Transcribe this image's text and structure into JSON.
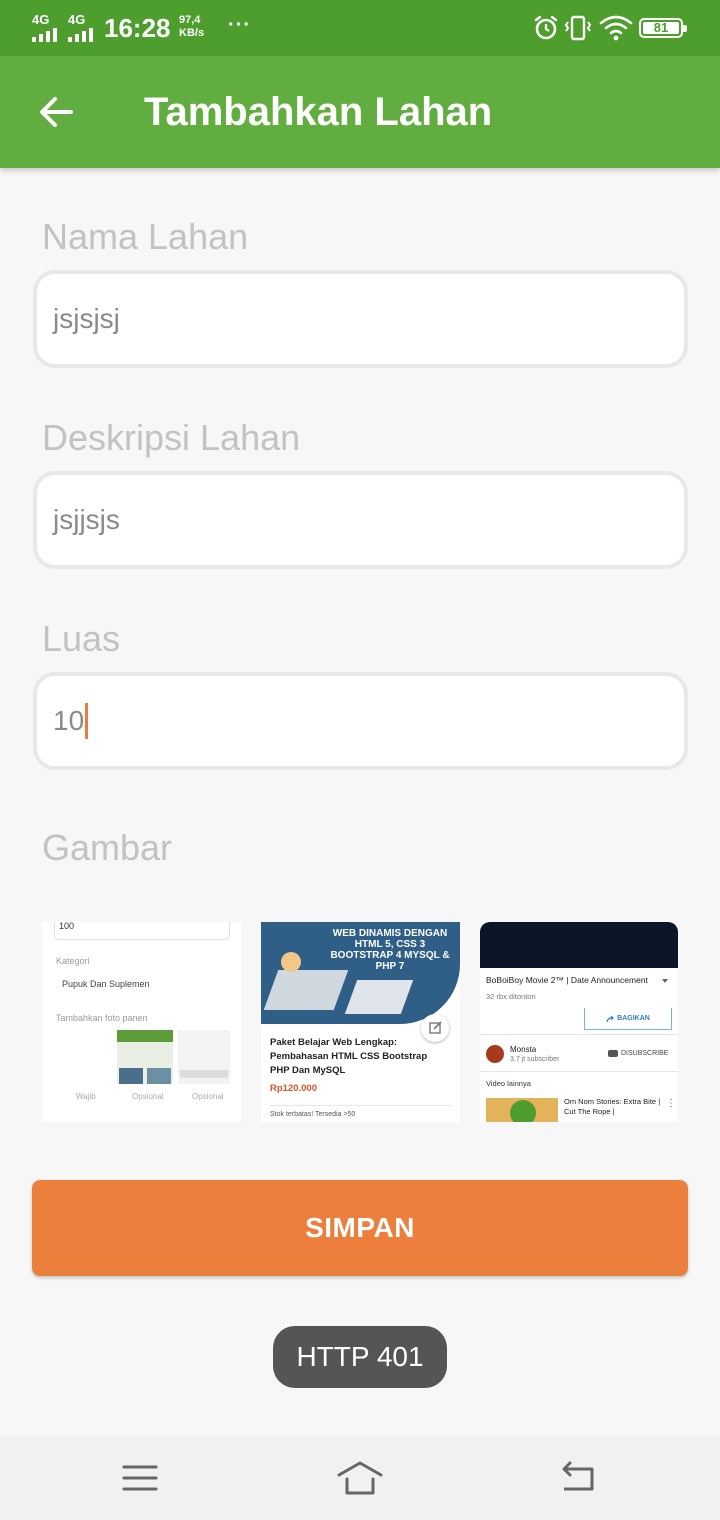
{
  "status_bar": {
    "sim1": "4G",
    "sim2": "4G",
    "time": "16:28",
    "speed_value": "97,4",
    "speed_unit": "KB/s",
    "more": "···",
    "battery": "81"
  },
  "app_bar": {
    "title": "Tambahkan Lahan"
  },
  "form": {
    "name_label": "Nama Lahan",
    "name_value": "jsjsjsj",
    "desc_label": "Deskripsi Lahan",
    "desc_value": "jsjjsjs",
    "area_label": "Luas",
    "area_value": "10",
    "image_label": "Gambar"
  },
  "thumbnails": {
    "t1": {
      "value": "100",
      "kategori": "Kategori",
      "kategori_value": "Pupuk Dan Suplemen",
      "foto": "Tambahkan foto panen",
      "cap1": "Wajib",
      "cap2": "Opsional",
      "cap3": "Opsional"
    },
    "t2": {
      "banner": "WEB DINAMIS DENGAN HTML 5, CSS 3 BOOTSTRAP 4 MYSQL & PHP 7",
      "title": "Paket Belajar Web Lengkap: Pembahasan HTML CSS Bootstrap PHP Dan MySQL",
      "price": "Rp120.000",
      "stock": "Stok terbatas! Tersedia >50"
    },
    "t3": {
      "title": "BoBoiBoy Movie 2™ | Date Announcement",
      "views": "32 rbx ditonton",
      "share": "BAGIKAN",
      "channel": "Monsta",
      "subs": "3,7 jt subscriber",
      "disub": "DISUBSCRIBE",
      "more": "Video lainnya",
      "next": "Om Nom Stories: Extra Bite | Cut The Rope |"
    }
  },
  "save_button": "SIMPAN",
  "toast": "HTTP 401",
  "colors": {
    "status_bar": "#4e9e2d",
    "app_bar": "#61ad40",
    "accent": "#ec7f3c"
  }
}
